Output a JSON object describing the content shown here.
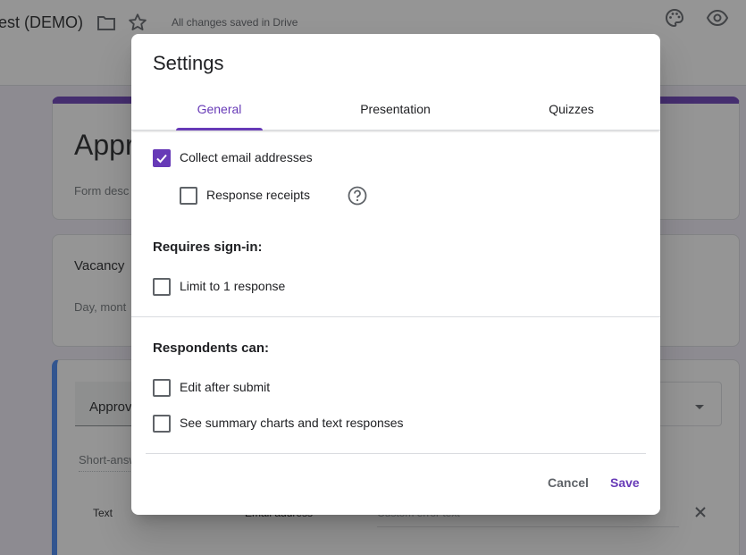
{
  "app": {
    "doc_title": "est (DEMO)",
    "saved_status": "All changes saved in Drive",
    "icons": [
      "folder-icon",
      "star-icon",
      "palette-icon",
      "eye-icon"
    ]
  },
  "form": {
    "title": "Appr",
    "description": "Form desc",
    "question1": {
      "title": "Vacancy",
      "hint": "Day, mont"
    },
    "question2": {
      "title": "Approv",
      "answer_hint": "Short-answ",
      "validation_type": "Text",
      "validation_kind": "Email address",
      "validation_error_placeholder": "Custom error text"
    }
  },
  "dialog": {
    "title": "Settings",
    "tabs": [
      {
        "label": "General",
        "active": true
      },
      {
        "label": "Presentation",
        "active": false
      },
      {
        "label": "Quizzes",
        "active": false
      }
    ],
    "options": {
      "collect_email": {
        "label": "Collect email addresses",
        "checked": true
      },
      "response_receipts": {
        "label": "Response receipts",
        "checked": false
      },
      "limit_one": {
        "label": "Limit to 1 response",
        "checked": false
      },
      "edit_after_submit": {
        "label": "Edit after submit",
        "checked": false
      },
      "see_summary": {
        "label": "See summary charts and text responses",
        "checked": false
      }
    },
    "sections": {
      "requires_signin": "Requires sign-in:",
      "respondents_can": "Respondents can:"
    },
    "buttons": {
      "cancel": "Cancel",
      "save": "Save"
    }
  },
  "colors": {
    "accent": "#673ab7",
    "header_band": "#4285f4"
  }
}
